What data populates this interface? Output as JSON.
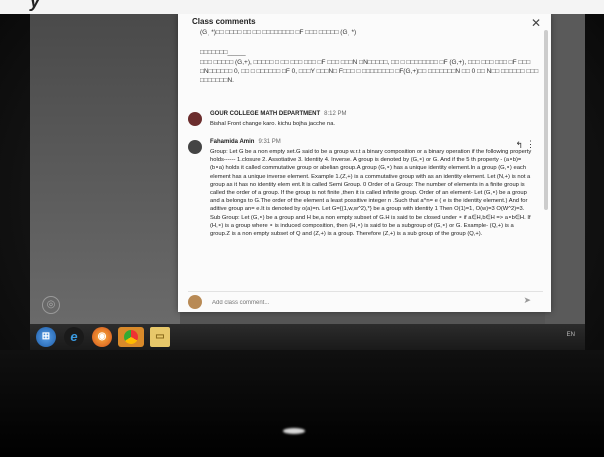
{
  "dialog": {
    "title": "Class comments",
    "scrambled_text": [
      "(Gˌ *)□□ □□□□ □□ □□ □□□□□□□□ □F □□□ □□□□□ (Gˌ *)",
      "□□□□□□□_____",
      "□□□ □□□□□ (G,+), □□□□□ □ □□ □□□ □□□ □F □□□ □□□N □N□□□□□, □□ □ □□□□□□□□ □F (G,+), □□□ □□□ □□□ □F □□□ □N□□□□□□ 0, □□ □ □□□□□□ □F 0, □□□Y □□□N□ F□□□ □ □□□□□□□□ □F(G,+)□□ □□□□□□□N □□ 0 □□ N□□ □□□□□□ □□□ □□□□□□□N."
    ]
  },
  "comments": [
    {
      "author": "GOUR COLLEGE MATH DEPARTMENT",
      "time": "8:12 PM",
      "text": "Bishal Front change karo. kichu bojha jacche na."
    },
    {
      "author": "Fahamida Amin",
      "time": "9:31 PM",
      "text": "Group: Let G be a non empty set.G said to be a group w.r.t a binary composition or a binary operation if the following property holds------ 1.closure 2. Assotiative 3. Identity 4. Inverse. A group is denoted by (G,∘) or G. And if the 5 th property - (a∘b)=(b∘a) holds it called commutative group or abelian group.A group (G,∘) has a unique identity element.In a group (G,∘) each element has a unique inverse element. Example 1.(Z,+) is a commutative group with as an identity element. Let (N,+) is not a group as it has no identity elem ent.It is called Semi Group. 0 Order of a Group: The number of elements in a finite group is called the order of a group. If the group is not finite ,then it is called infinite group. Order of an element- Let (G,∘) be a group and a belongs to G.The order of the element a least possitive integer n .Such that a^n= e ( e is the identity element.) And for aditive group an= e.It is denoted by o(a)=n. Let G={(1,w,w^2),*} be a group with identity 1 Then O(1)=1, O(w)=3 O(W^2)=3. Sub Group: Let (G,∘) be a group and H be,a non empty subset of G.H is said to be closed under ∘ if a∈H,b∈H => a∘b∈H. If (H,∘) is a group where ∘ is induced composition, then (H,∘) is said to be a subgroup of (G,∘) or G. Example- (Q,+) is a group.Z is a non empty subset of Q and (Z,+) is a group. Therefore (Z,+) is a sub group of the group (Q,+)."
    }
  ],
  "composer": {
    "placeholder": "Add class comment...",
    "send_icon": "send-icon"
  },
  "taskbar": {
    "icons": [
      "windows-start-icon",
      "internet-explorer-icon",
      "firefox-icon",
      "chrome-icon",
      "folder-icon"
    ],
    "tray_text": "EN"
  },
  "photo_caption": "y"
}
